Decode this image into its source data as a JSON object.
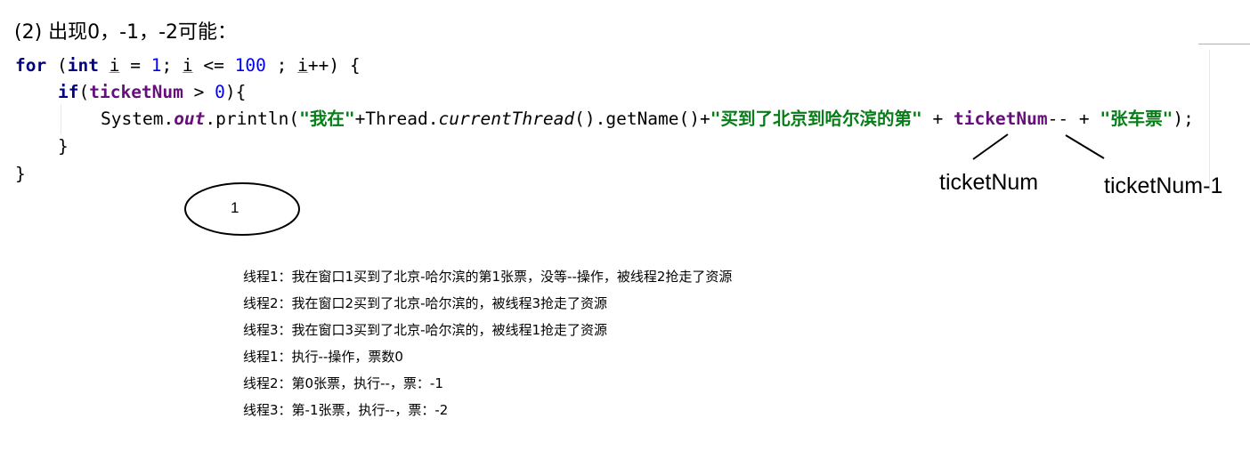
{
  "heading": "(2) 出现0，-1，-2可能：",
  "code": {
    "line1": {
      "kw_for": "for",
      "p1": " (",
      "kw_int": "int",
      "p2": " ",
      "var_i": "i",
      "p3": " = ",
      "num_1": "1",
      "p4": "; ",
      "var_i2": "i",
      "p5": " <= ",
      "num_100": "100",
      "p6": " ; ",
      "var_i3": "i",
      "p7": "++) {"
    },
    "line2": {
      "kw_if": "if",
      "p1": "(",
      "field": "ticketNum",
      "p2": " > ",
      "num_0": "0",
      "p3": "){"
    },
    "line3": {
      "p1": "System.",
      "out": "out",
      "p2": ".println(",
      "str1": "\"我在\"",
      "p3": "+Thread.",
      "method": "currentThread",
      "p4": "().getName()+",
      "str2": "\"买到了北京到哈尔滨的第\"",
      "p5": " + ",
      "field": "ticketNum",
      "p6": "-- + ",
      "str3": "\"张车票\"",
      "p7": ");"
    },
    "line4": "}",
    "line5": "}"
  },
  "annotations": {
    "ticketnum": "ticketNum",
    "ticketnum_minus1": "ticketNum-1",
    "oval_label": "1"
  },
  "steps": [
    "线程1：我在窗口1买到了北京-哈尔滨的第1张票，没等--操作，被线程2抢走了资源",
    "线程2：我在窗口2买到了北京-哈尔滨的，被线程3抢走了资源",
    "线程3：我在窗口3买到了北京-哈尔滨的，被线程1抢走了资源",
    "线程1：执行--操作，票数0",
    "线程2：第0张票，执行--，票：-1",
    "线程3：第-1张票，执行--，票：-2"
  ],
  "colors": {
    "keyword": "#000080",
    "number": "#0000ff",
    "field": "#660e7a",
    "string": "#067d17"
  }
}
